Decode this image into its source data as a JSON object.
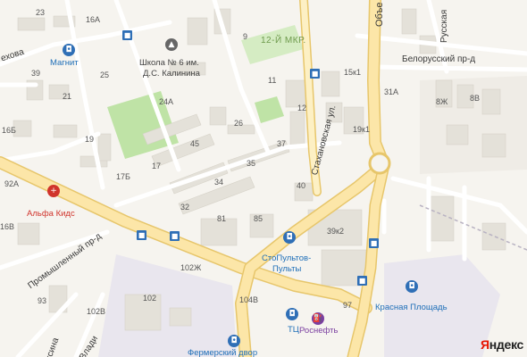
{
  "map": {
    "district": "12-Й МКР.",
    "streets": {
      "obyezd": "Объе",
      "russkaya": "Русская",
      "belorussky": "Белорусский пр-д",
      "stakhanovskaya": "Стахановская ул.",
      "promyshlenny": "Промышленный пр-д",
      "chekhova": "ехова",
      "vladi": "Влади",
      "ksina": "ксина"
    },
    "pois": {
      "magnit": "Магнит",
      "school_line1": "Школа № 6 им.",
      "school_line2": "Д.С. Калинина",
      "alfa_kids": "Альфа Кидс",
      "stopulty_line1": "СтоПультов-",
      "stopulty_line2": "Пульты",
      "tc": "ТЦ",
      "rosneft": "Роснефть",
      "krasnaya_ploshad": "Красная Площадь",
      "fermersky_dvor": "Фермерский двор"
    },
    "house_numbers": [
      "23",
      "16А",
      "39",
      "25",
      "21",
      "16Б",
      "19",
      "17",
      "17Б",
      "92А",
      "16В",
      "24А",
      "45",
      "26",
      "9",
      "11",
      "12",
      "15к1",
      "31А",
      "8В",
      "8Ж",
      "19к1",
      "37",
      "35",
      "34",
      "32",
      "40",
      "81",
      "85",
      "39к2",
      "102Ж",
      "102",
      "102В",
      "93",
      "104В",
      "97"
    ],
    "attribution": {
      "ya": "Я",
      "rest": "ндекс"
    },
    "colors": {
      "background": "#f6f4ef",
      "major_road": "#fce6a8",
      "road_outline": "#e7c66b",
      "park": "#bfe3a6",
      "building": "#e4e1d9",
      "industrial": "#e9e6ee",
      "transit": "#2f6fb6"
    },
    "icons": {
      "bus_stop": "bus-stop-icon",
      "shop": "shopping-bag-icon",
      "school": "school-icon",
      "pharmacy": "medical-cross-icon",
      "fuel": "fuel-station-icon",
      "tc": "shopping-center-icon"
    }
  }
}
